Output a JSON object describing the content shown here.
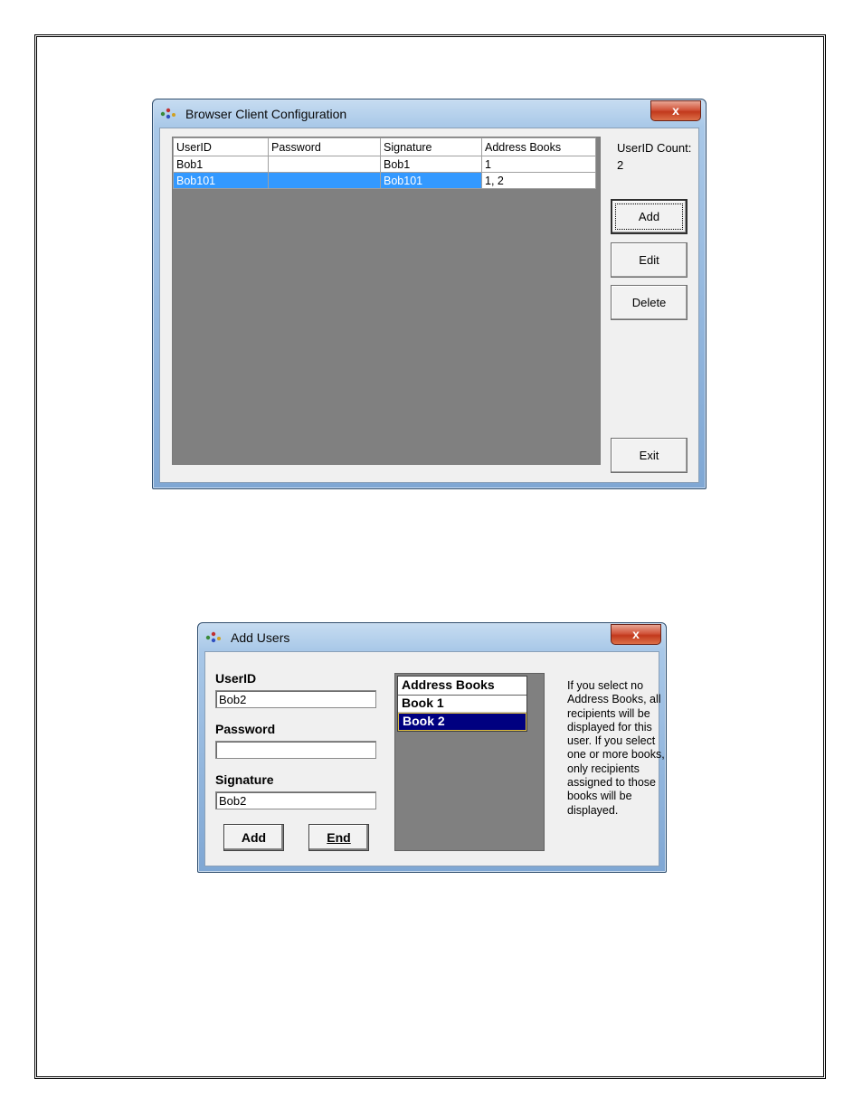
{
  "config_window": {
    "title": "Browser Client Configuration",
    "close_label": "x",
    "columns": [
      "UserID",
      "Password",
      "Signature",
      "Address Books"
    ],
    "rows": [
      [
        "Bob1",
        "",
        "Bob1",
        "1"
      ],
      [
        "Bob101",
        "",
        "Bob101",
        "1, 2"
      ]
    ],
    "count_label": "UserID Count:",
    "count_value": "2",
    "add_label": "Add",
    "edit_label": "Edit",
    "delete_label": "Delete",
    "exit_label": "Exit"
  },
  "add_users_window": {
    "title": "Add Users",
    "close_label": "x",
    "userid_label": "UserID",
    "userid_value": "Bob2",
    "password_label": "Password",
    "password_value": "",
    "signature_label": "Signature",
    "signature_value": "Bob2",
    "add_label": "Add",
    "end_label": "End",
    "listbox_header": "Address Books",
    "books": [
      "Book 1",
      "Book 2"
    ],
    "selected_book": "Book 2",
    "help_text": "If you select no Address Books, all recipients will be displayed for this user.  If you select one or more books, only recipients assigned to those books will be displayed."
  },
  "colors": {
    "selection": "#3399ff",
    "listbox_selection": "#000080",
    "grid_background": "#808080"
  }
}
